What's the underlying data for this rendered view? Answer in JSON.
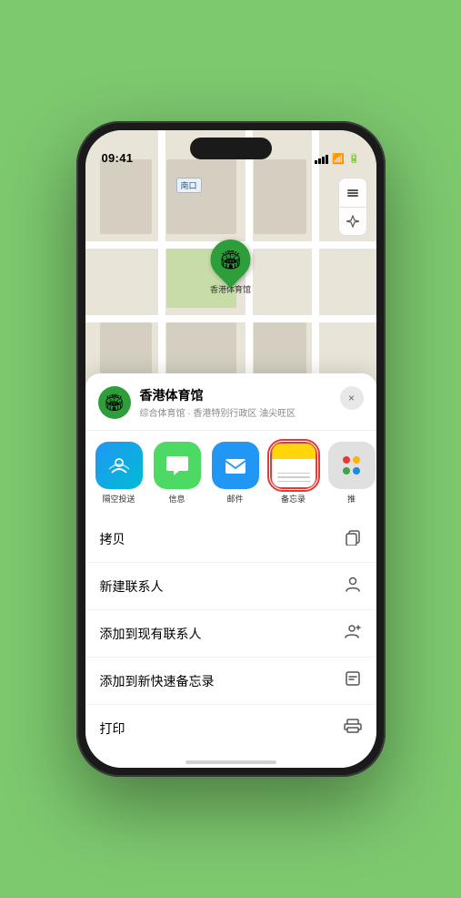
{
  "status_bar": {
    "time": "09:41",
    "location_arrow": "▶",
    "signal": "▌▌▌▌",
    "wifi": "wifi",
    "battery": "battery"
  },
  "map": {
    "label_text": "南口",
    "marker_label": "香港体育馆",
    "marker_emoji": "🏟"
  },
  "venue": {
    "name": "香港体育馆",
    "subtitle": "综合体育馆 · 香港特别行政区 油尖旺区",
    "icon_emoji": "🏟"
  },
  "share_items": [
    {
      "id": "airdrop",
      "label": "隔空投送",
      "type": "airdrop"
    },
    {
      "id": "messages",
      "label": "信息",
      "type": "messages"
    },
    {
      "id": "mail",
      "label": "邮件",
      "type": "mail"
    },
    {
      "id": "notes",
      "label": "备忘录",
      "type": "notes",
      "selected": true
    },
    {
      "id": "more",
      "label": "推",
      "type": "more"
    }
  ],
  "action_items": [
    {
      "id": "copy",
      "label": "拷贝",
      "icon": "copy"
    },
    {
      "id": "new-contact",
      "label": "新建联系人",
      "icon": "person"
    },
    {
      "id": "add-existing",
      "label": "添加到现有联系人",
      "icon": "person-add"
    },
    {
      "id": "add-notes",
      "label": "添加到新快速备忘录",
      "icon": "note"
    },
    {
      "id": "print",
      "label": "打印",
      "icon": "print"
    }
  ],
  "close_label": "×",
  "home_indicator": true
}
